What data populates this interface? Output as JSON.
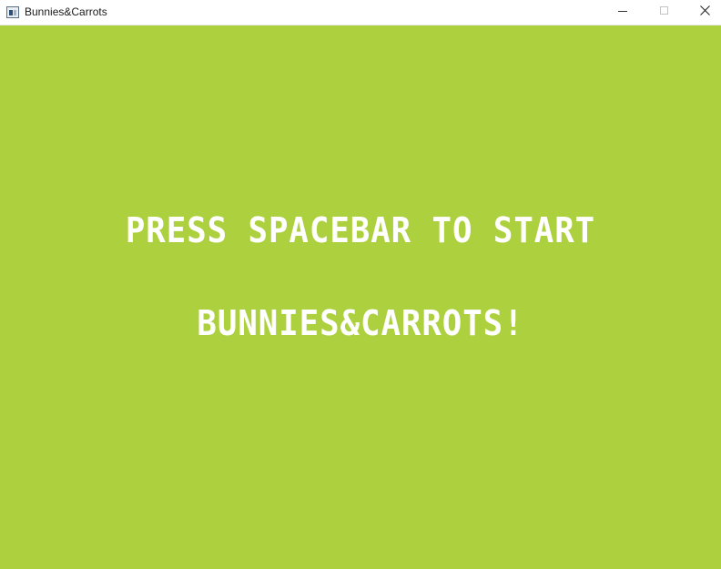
{
  "window": {
    "title": "Bunnies&Carrots",
    "icon": "app-window-icon"
  },
  "titlebar_buttons": {
    "minimize_icon": "minimize-icon",
    "maximize_icon": "maximize-icon",
    "close_icon": "close-icon"
  },
  "game": {
    "background_color": "#add03e",
    "text_color": "#ffffff",
    "start_prompt": "PRESS SPACEBAR TO START",
    "game_title": "BUNNIES&CARROTS!"
  }
}
